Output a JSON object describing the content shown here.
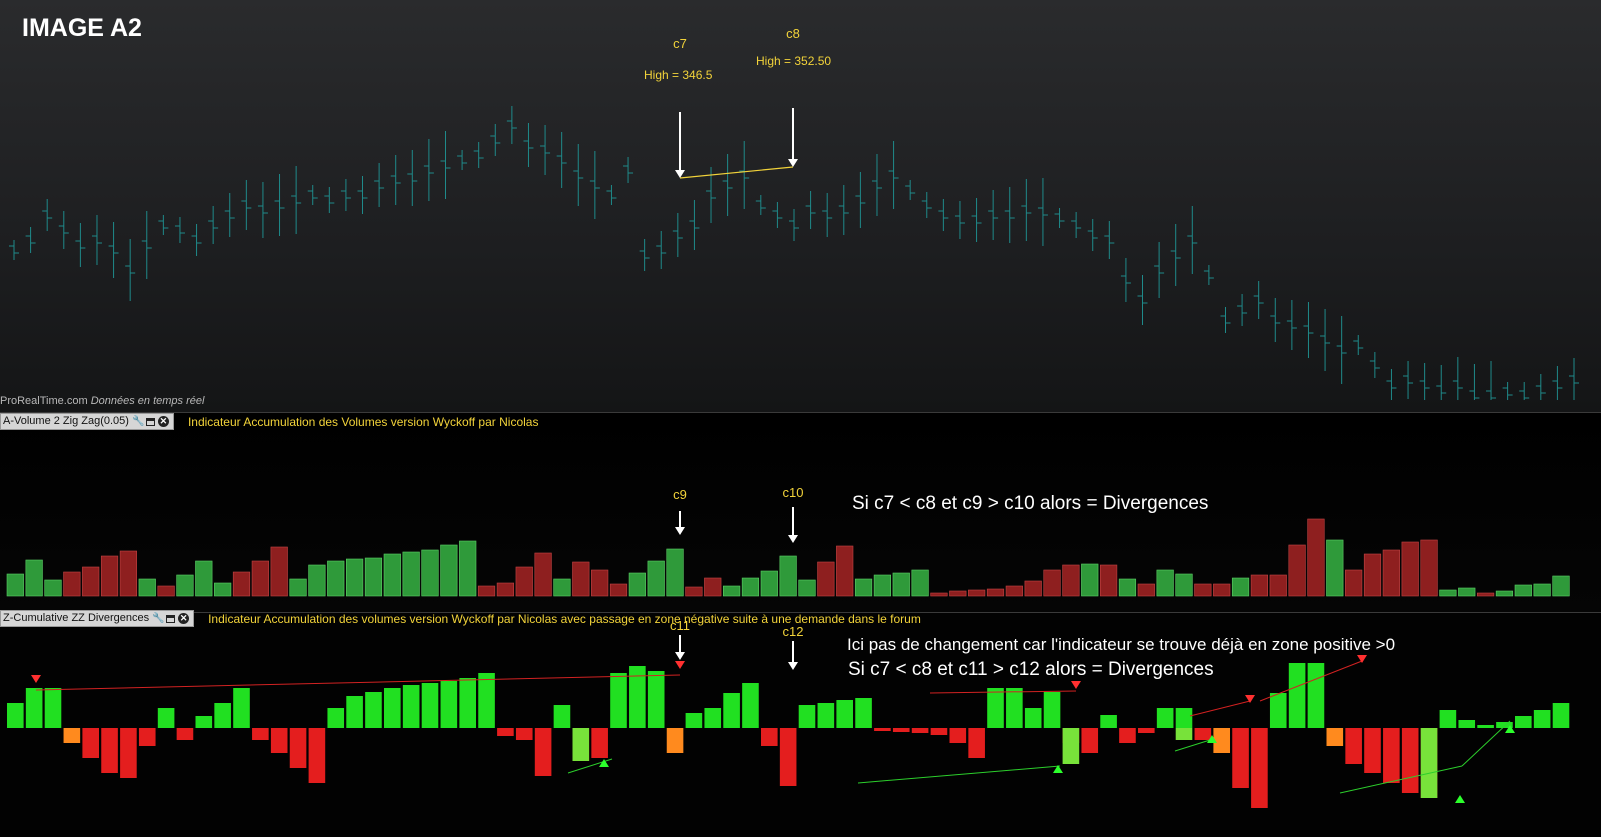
{
  "image_title": "IMAGE A2",
  "watermark": {
    "brand": "ProRealTime.com",
    "status": "Données en temps réel"
  },
  "price_annotations": {
    "c7": {
      "label": "c7",
      "high": "High  = 346.5"
    },
    "c8": {
      "label": "c8",
      "high": "High = 352.50"
    }
  },
  "volume_indicator": {
    "tab_label": "A-Volume 2 Zig Zag(0.05)",
    "description": "Indicateur Accumulation des Volumes version Wyckoff par Nicolas",
    "c9": "c9",
    "c10": "c10",
    "rule": "Si c7 < c8 et c9 > c10 alors = Divergences"
  },
  "divergence_indicator": {
    "tab_label": "Z-Cumulative ZZ Divergences",
    "description": "Indicateur Accumulation des volumes version Wyckoff par Nicolas avec passage en zone négative suite à une demande dans le forum",
    "c11": "c11",
    "c12": "c12",
    "note": "Ici pas de changement car l'indicateur se trouve déjà en zone positive >0",
    "rule": "Si c7 < c8 et c11 > c12 alors = Divergences"
  },
  "colors": {
    "price_bar": "#1f8a8a",
    "volume_up": "#2f9a3a",
    "volume_down": "#8e1f1f",
    "div_pos": "#21e021",
    "div_neg": "#e41e1e",
    "div_peak": "#ff8a1e",
    "annotation": "#f2d33a"
  },
  "icons": [
    "wrench-icon",
    "window-icon",
    "close-icon",
    "down-arrow-icon",
    "up-arrow-icon"
  ]
}
